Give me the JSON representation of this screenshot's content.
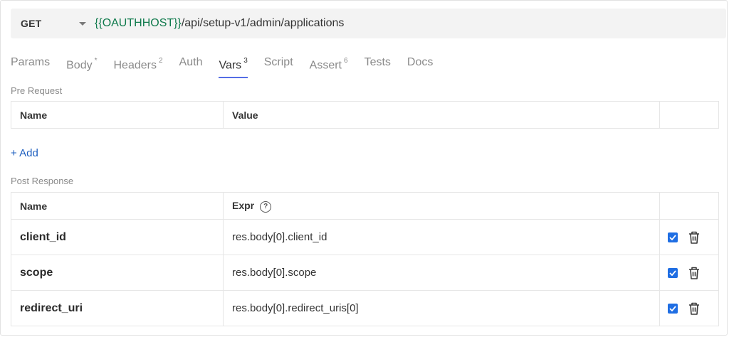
{
  "request": {
    "method": "GET",
    "url_var": "{{OAUTHHOST}}",
    "url_path": "/api/setup-v1/admin/applications"
  },
  "tabs": [
    {
      "label": "Params",
      "badge": ""
    },
    {
      "label": "Body",
      "badge": "*"
    },
    {
      "label": "Headers",
      "badge": "2"
    },
    {
      "label": "Auth",
      "badge": ""
    },
    {
      "label": "Vars",
      "badge": "3",
      "active": true
    },
    {
      "label": "Script",
      "badge": ""
    },
    {
      "label": "Assert",
      "badge": "6"
    },
    {
      "label": "Tests",
      "badge": ""
    },
    {
      "label": "Docs",
      "badge": ""
    }
  ],
  "pre_request": {
    "label": "Pre Request",
    "col_name": "Name",
    "col_value": "Value",
    "add_label": "+ Add"
  },
  "post_response": {
    "label": "Post Response",
    "col_name": "Name",
    "col_expr": "Expr",
    "help_glyph": "?",
    "rows": [
      {
        "name": "client_id",
        "expr": "res.body[0].client_id",
        "enabled": true
      },
      {
        "name": "scope",
        "expr": "res.body[0].scope",
        "enabled": true
      },
      {
        "name": "redirect_uri",
        "expr": "res.body[0].redirect_uris[0]",
        "enabled": true
      }
    ]
  },
  "colors": {
    "accent": "#546de5",
    "checkbox": "#1f6ee3",
    "var_green": "#0f7a4c",
    "link_blue": "#1e5fbf"
  }
}
